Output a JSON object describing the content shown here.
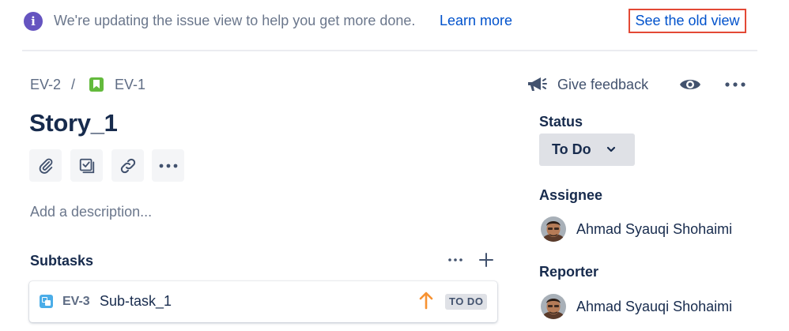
{
  "banner": {
    "message": "We're updating the issue view to help you get more done.",
    "learn_more": "Learn more",
    "old_view": "See the old view",
    "info_icon_glyph": "i"
  },
  "breadcrumb": {
    "parent": "EV-2",
    "separator": "/",
    "current": "EV-1"
  },
  "issue": {
    "title": "Story_1",
    "description_placeholder": "Add a description..."
  },
  "subtasks": {
    "heading": "Subtasks",
    "items": [
      {
        "key": "EV-3",
        "summary": "Sub-task_1",
        "status": "TO DO",
        "priority": "high"
      }
    ]
  },
  "header_actions": {
    "feedback": "Give feedback"
  },
  "fields": {
    "status_label": "Status",
    "status_value": "To Do",
    "assignee_label": "Assignee",
    "assignee_name": "Ahmad Syauqi Shohaimi",
    "reporter_label": "Reporter",
    "reporter_name": "Ahmad Syauqi Shohaimi"
  },
  "colors": {
    "link": "#0052CC",
    "info": "#6554C0",
    "story": "#63BA3C",
    "subtask": "#4BADE8",
    "priority_high": "#F79232",
    "highlight_border": "#E34935"
  }
}
